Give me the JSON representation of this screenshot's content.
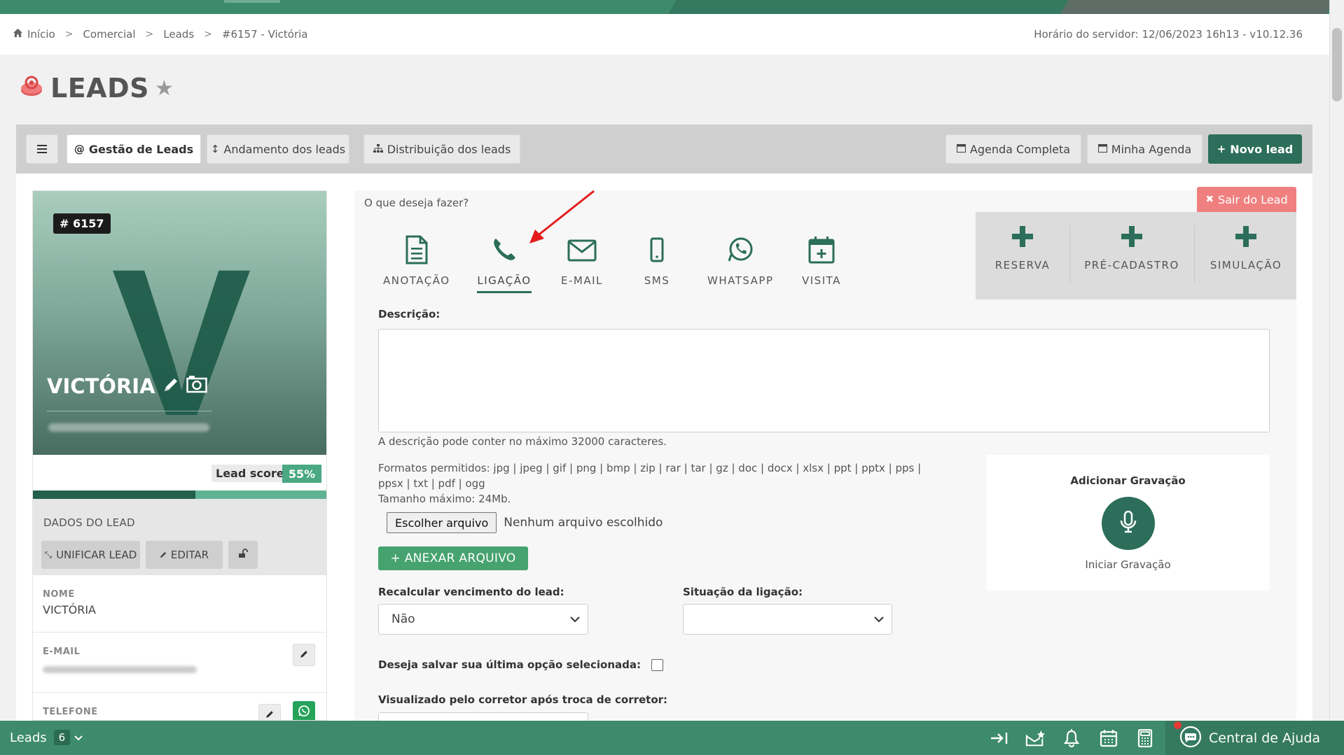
{
  "breadcrumb": {
    "items": [
      "Início",
      "Comercial",
      "Leads",
      "#6157 - Victória"
    ]
  },
  "server_time": "Horário do servidor: 12/06/2023 16h13 - v10.12.36",
  "page": {
    "title": "LEADS"
  },
  "toolbar": {
    "gestao": "Gestão de Leads",
    "andamento": "Andamento dos leads",
    "distribuicao": "Distribuição dos leads",
    "agenda_completa": "Agenda Completa",
    "minha_agenda": "Minha Agenda",
    "novo_lead": "Novo lead"
  },
  "lead": {
    "id": "# 6157",
    "initial": "V",
    "name": "VICTÓRIA",
    "score_label": "Lead score",
    "score": "55%",
    "score_fraction": 0.55,
    "dados_title": "DADOS DO LEAD",
    "unificar": "UNIFICAR LEAD",
    "editar": "EDITAR",
    "fields": {
      "nome_label": "NOME",
      "nome_value": "VICTÓRIA",
      "email_label": "E-MAIL",
      "telefone_label": "TELEFONE"
    }
  },
  "actions": {
    "question": "O que deseja fazer?",
    "sair": "Sair do Lead",
    "items": [
      {
        "label": "ANOTAÇÃO",
        "icon": "note-icon"
      },
      {
        "label": "LIGAÇÃO",
        "icon": "phone-icon"
      },
      {
        "label": "E-MAIL",
        "icon": "envelope-icon"
      },
      {
        "label": "SMS",
        "icon": "mobile-icon"
      },
      {
        "label": "WHATSAPP",
        "icon": "whatsapp-icon"
      },
      {
        "label": "VISITA",
        "icon": "calendar-plus-icon"
      }
    ],
    "extra": [
      "RESERVA",
      "PRÉ-CADASTRO",
      "SIMULAÇÃO"
    ]
  },
  "form": {
    "descricao_label": "Descrição:",
    "descricao_hint": "A descrição pode conter no máximo 32000 caracteres.",
    "formats_line1": "Formatos permitidos: jpg | jpeg | gif | png | bmp | zip | rar | tar | gz | doc | docx | xlsx | ppt | pptx | pps |",
    "formats_line2": "ppsx | txt | pdf | ogg",
    "max_size": "Tamanho máximo: 24Mb.",
    "file_button": "Escolher arquivo",
    "file_none": "Nenhum arquivo escolhido",
    "anexar": "+ ANEXAR ARQUIVO",
    "recalcular_label": "Recalcular vencimento do lead:",
    "recalcular_value": "Não",
    "situacao_label": "Situação da ligação:",
    "situacao_value": "",
    "salvar_label": "Deseja salvar sua última opção selecionada:",
    "visualizado_label": "Visualizado pelo corretor após troca de corretor:"
  },
  "gravacao": {
    "title": "Adicionar Gravação",
    "start": "Iniciar Gravação"
  },
  "bottombar": {
    "leads": "Leads",
    "count": "6",
    "help": "Central de Ajuda"
  },
  "colors": {
    "brand_green": "#3d8a6c",
    "dark_green": "#2c6e5a",
    "danger": "#f08080"
  }
}
